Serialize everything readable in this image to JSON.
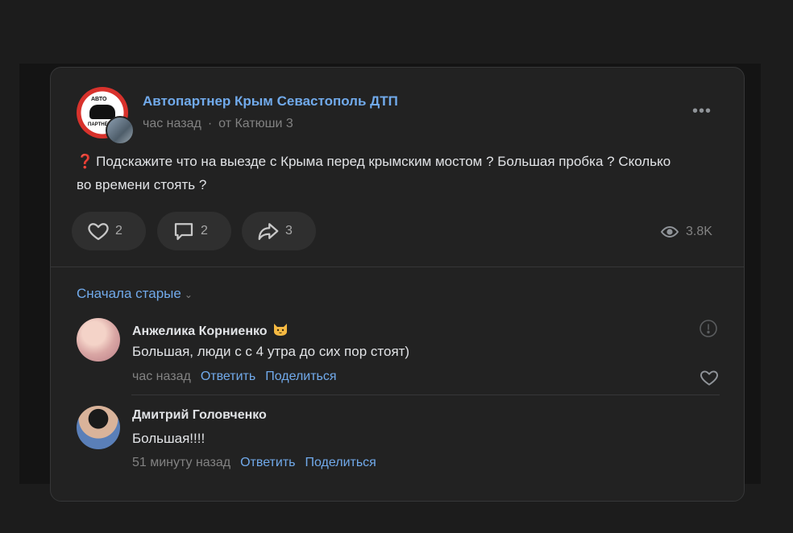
{
  "post": {
    "group_name": "Автопартнер Крым Севастополь ДТП",
    "logo_text_top": "АВТО",
    "logo_text_bottom": "ПАРТНЁР",
    "time": "час назад",
    "from": "от Катюши 3",
    "question_mark": "❓",
    "text": "Подскажите что на выезде с Крыма перед крымским мостом ? Большая пробка ? Сколько во времени стоять ?",
    "likes": "2",
    "comments": "2",
    "shares": "3",
    "views": "3.8K"
  },
  "comments_section": {
    "sort_label": "Сначала старые",
    "items": [
      {
        "author": "Анжелика Корниенко",
        "badge_icon": "cat-face-emoji",
        "text": "Большая, люди с с 4 утра до сих пор стоят)",
        "time": "час назад",
        "reply": "Ответить",
        "share": "Поделиться"
      },
      {
        "author": "Дмитрий Головченко",
        "text": "Большая!!!!",
        "time": "51 минуту назад",
        "reply": "Ответить",
        "share": "Поделиться"
      }
    ]
  },
  "colors": {
    "accent": "#71aaeb",
    "card_bg": "#222222",
    "page_bg": "#1c1c1c",
    "muted": "#828282"
  }
}
